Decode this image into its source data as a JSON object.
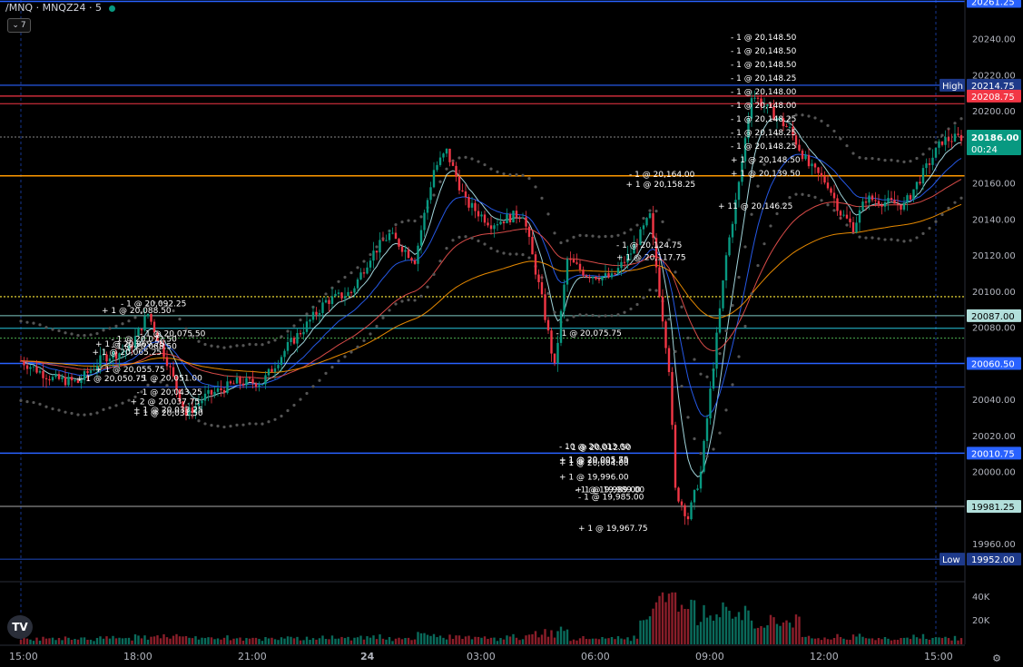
{
  "header": {
    "symbol": "/MNQ · MNQZ24 · 5",
    "indicator_count": "7"
  },
  "colors": {
    "bg": "#000000",
    "up": "#089981",
    "down": "#f23645",
    "accent": "#2962ff",
    "current_price": "#089981"
  },
  "chart_data": {
    "type": "candlestick",
    "symbol": "MNQZ24",
    "timeframe": "5",
    "ylim": [
      19940,
      20262
    ],
    "y_ticks": [
      19960,
      19980,
      20000,
      20020,
      20040,
      20060,
      20080,
      20100,
      20120,
      20140,
      20160,
      20180,
      20200,
      20220,
      20240
    ],
    "y_tick_labels": [
      "19960.00",
      "19980.00",
      "20000.00",
      "20020.00",
      "20040.00",
      "20060.00",
      "20080.00",
      "20100.00",
      "20120.00",
      "20140.00",
      "20160.00",
      "20180.00",
      "20200.00",
      "20220.00",
      "20240.00"
    ],
    "volume_ticks": [
      {
        "label": "40K",
        "value": 40000
      },
      {
        "label": "20K",
        "value": 20000
      }
    ],
    "x_ticks": [
      {
        "label": "15:00",
        "bar": 0
      },
      {
        "label": "18:00",
        "bar": 36
      },
      {
        "label": "21:00",
        "bar": 72
      },
      {
        "label": "24",
        "bar": 108,
        "bold": true
      },
      {
        "label": "03:00",
        "bar": 144
      },
      {
        "label": "06:00",
        "bar": 180
      },
      {
        "label": "09:00",
        "bar": 216
      },
      {
        "label": "12:00",
        "bar": 252
      },
      {
        "label": "15:00",
        "bar": 288
      }
    ],
    "price_path": [
      [
        0,
        20062
      ],
      [
        10,
        20052
      ],
      [
        18,
        20050
      ],
      [
        26,
        20064
      ],
      [
        34,
        20068
      ],
      [
        40,
        20088
      ],
      [
        46,
        20062
      ],
      [
        52,
        20032
      ],
      [
        58,
        20042
      ],
      [
        68,
        20050
      ],
      [
        76,
        20050
      ],
      [
        84,
        20070
      ],
      [
        90,
        20082
      ],
      [
        96,
        20095
      ],
      [
        104,
        20100
      ],
      [
        110,
        20120
      ],
      [
        116,
        20132
      ],
      [
        124,
        20118
      ],
      [
        130,
        20168
      ],
      [
        134,
        20178
      ],
      [
        140,
        20150
      ],
      [
        148,
        20138
      ],
      [
        158,
        20144
      ],
      [
        164,
        20096
      ],
      [
        168,
        20058
      ],
      [
        172,
        20118
      ],
      [
        178,
        20110
      ],
      [
        186,
        20108
      ],
      [
        192,
        20122
      ],
      [
        198,
        20142
      ],
      [
        204,
        20058
      ],
      [
        206,
        19990
      ],
      [
        210,
        19975
      ],
      [
        214,
        20000
      ],
      [
        218,
        20060
      ],
      [
        222,
        20120
      ],
      [
        226,
        20160
      ],
      [
        230,
        20210
      ],
      [
        236,
        20200
      ],
      [
        242,
        20190
      ],
      [
        248,
        20170
      ],
      [
        254,
        20160
      ],
      [
        258,
        20144
      ],
      [
        262,
        20136
      ],
      [
        266,
        20152
      ],
      [
        272,
        20150
      ],
      [
        278,
        20148
      ],
      [
        284,
        20166
      ],
      [
        290,
        20184
      ],
      [
        296,
        20186
      ]
    ],
    "horizontal_levels": [
      {
        "price": 20261.25,
        "color": "#2962ff",
        "width": 1.5,
        "label": "20261.25"
      },
      {
        "price": 20214.75,
        "color": "#2962ff",
        "width": 1.2,
        "label": "20214.75",
        "tag": "High"
      },
      {
        "price": 20208.75,
        "color": "#f23645",
        "width": 1.2,
        "label": "20208.75"
      },
      {
        "price": 20204.5,
        "color": "#f23645",
        "width": 1.0
      },
      {
        "price": 20186.0,
        "color": "#888888",
        "width": 1.0,
        "dash": true
      },
      {
        "price": 20164.5,
        "color": "#ff9800",
        "width": 1.5
      },
      {
        "price": 20097.5,
        "color": "#ffeb3b",
        "width": 1.2,
        "dash": true
      },
      {
        "price": 20087.0,
        "color": "#80cbc4",
        "width": 1.0,
        "label": "20087.00"
      },
      {
        "price": 20080.0,
        "color": "#26c6da",
        "width": 1.0
      },
      {
        "price": 20074.5,
        "color": "#4caf50",
        "width": 1.0,
        "dash": true
      },
      {
        "price": 20060.5,
        "color": "#2962ff",
        "width": 1.5,
        "label": "20060.50"
      },
      {
        "price": 20047.5,
        "color": "#2962ff",
        "width": 0.8
      },
      {
        "price": 20010.75,
        "color": "#2962ff",
        "width": 1.5,
        "label": "20010.75"
      },
      {
        "price": 19981.25,
        "color": "#aaaaaa",
        "width": 1.0,
        "label": "19981.25"
      },
      {
        "price": 19952.0,
        "color": "#2962ff",
        "width": 0.8,
        "label": "19952.00",
        "tag": "Low"
      }
    ],
    "current_price": {
      "label": "20186.00",
      "countdown": "00:24",
      "price": 20186.0
    },
    "trade_annotations": [
      {
        "text": "- 1 @ 20,092.25",
        "bar": 40,
        "price": 20092.25
      },
      {
        "text": "- 1 @ 20,072.50",
        "bar": 37,
        "price": 20072.5
      },
      {
        "text": "- 1 @ 20,068.50",
        "bar": 37,
        "price": 20068.5
      },
      {
        "text": "- 1 @ 20,043.25",
        "bar": 45,
        "price": 20043.25
      },
      {
        "text": "- 1 @ 20,051.00",
        "bar": 45,
        "price": 20051.0
      },
      {
        "text": "+ 1 @ 20,055.75",
        "bar": 32,
        "price": 20055.75
      },
      {
        "text": "+ 1 @ 20,088.50",
        "bar": 34,
        "price": 20088.5
      },
      {
        "text": "+ 1 @ 20,069.75",
        "bar": 32,
        "price": 20069.75
      },
      {
        "text": "- 1 @ 20,075.50",
        "bar": 46,
        "price": 20075.5
      },
      {
        "text": "+ 1 @ 20,065.25",
        "bar": 31,
        "price": 20065.25
      },
      {
        "text": "+ 1 @ 20,050.75",
        "bar": 26,
        "price": 20050.75
      },
      {
        "text": "+ 1 @ 20,033.25",
        "bar": 44,
        "price": 20033.25
      },
      {
        "text": "+ 1 @ 20,031.50",
        "bar": 44,
        "price": 20031.5
      },
      {
        "text": "+ 2 @ 20,037.75",
        "bar": 43,
        "price": 20037.75
      },
      {
        "text": "- 1 @ 20,075.75",
        "bar": 177,
        "price": 20075.75
      },
      {
        "text": "- 1 @ 20,012.50",
        "bar": 180,
        "price": 20012.5
      },
      {
        "text": "- 10 @ 20,013.00",
        "bar": 178,
        "price": 20013.0
      },
      {
        "text": "- 1 @ 19,989.00",
        "bar": 183,
        "price": 19989.0
      },
      {
        "text": "- 1 @ 19,985.00",
        "bar": 184,
        "price": 19985.0
      },
      {
        "text": "+ 1 @ 20,005.75",
        "bar": 178,
        "price": 20005.75
      },
      {
        "text": "+ 1 @ 20,004.00",
        "bar": 178,
        "price": 20004.0
      },
      {
        "text": "+ 1 @ 20,005.50",
        "bar": 178,
        "price": 20005.5
      },
      {
        "text": "+ 1 @ 19,989.00",
        "bar": 183,
        "price": 19989.0
      },
      {
        "text": "+ 1 @ 19,996.00",
        "bar": 178,
        "price": 19996.0
      },
      {
        "text": "+ 1 @ 19,967.75",
        "bar": 184,
        "price": 19967.75
      },
      {
        "text": "- 1 @ 20,164.00",
        "bar": 200,
        "price": 20164.0
      },
      {
        "text": "- 1 @ 20,124.75",
        "bar": 196,
        "price": 20124.75
      },
      {
        "text": "+ 1 @ 20,158.25",
        "bar": 199,
        "price": 20158.25
      },
      {
        "text": "+ 1 @ 20,117.75",
        "bar": 196,
        "price": 20117.75
      },
      {
        "text": "- 1 @ 20,148.50",
        "bar": 232,
        "price": 20148.5
      },
      {
        "text": "- 1 @ 20,148.50",
        "bar": 232,
        "price": 20148.5
      },
      {
        "text": "- 1 @ 20,148.50",
        "bar": 232,
        "price": 20148.5
      },
      {
        "text": "- 1 @ 20,148.25",
        "bar": 232,
        "price": 20148.25
      },
      {
        "text": "- 1 @ 20,148.00",
        "bar": 232,
        "price": 20148.0
      },
      {
        "text": "- 1 @ 20,148.00",
        "bar": 232,
        "price": 20148.0
      },
      {
        "text": "- 1 @ 20,148.25",
        "bar": 232,
        "price": 20148.25
      },
      {
        "text": "- 1 @ 20,148.25",
        "bar": 232,
        "price": 20148.25
      },
      {
        "text": "- 1 @ 20,148.25",
        "bar": 232,
        "price": 20148.25
      },
      {
        "text": "+ 1 @ 20,148.50",
        "bar": 232,
        "price": 20148.5
      },
      {
        "text": "+ 1 @ 20,139.50",
        "bar": 232,
        "price": 20139.5
      },
      {
        "text": "+ 11 @ 20,146.25",
        "bar": 228,
        "price": 20146.25
      }
    ]
  }
}
